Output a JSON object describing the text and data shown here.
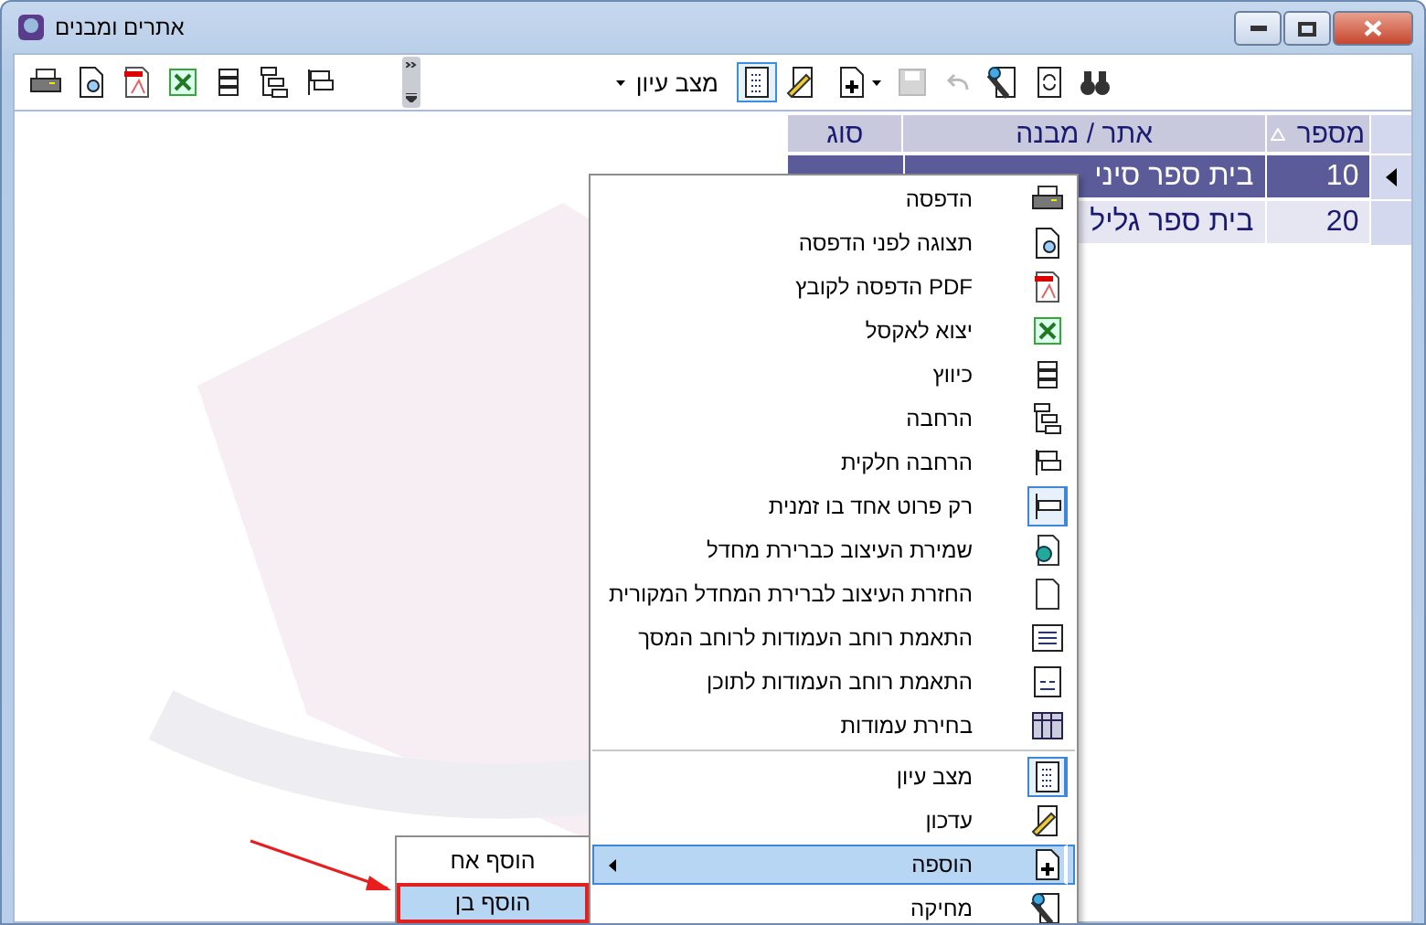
{
  "window": {
    "title": "אתרים ומבנים"
  },
  "toolbar": {
    "left_tools": [
      {
        "disabled": false
      },
      {
        "disabled": false
      },
      {
        "disabled": false
      },
      {
        "disabled": false
      },
      {
        "disabled": false
      },
      {
        "disabled": false
      },
      {
        "disabled": false
      }
    ],
    "view_mode": {
      "value": "מצב עיון"
    },
    "right_tools": [
      {
        "selected": true,
        "disabled": false,
        "dropdown": false
      },
      {
        "selected": false,
        "disabled": false,
        "dropdown": false
      },
      {
        "selected": false,
        "disabled": false,
        "dropdown": true
      },
      {
        "selected": false,
        "disabled": true,
        "dropdown": false
      },
      {
        "selected": false,
        "disabled": true,
        "dropdown": false
      },
      {
        "selected": false,
        "disabled": false,
        "dropdown": false
      },
      {
        "selected": false,
        "disabled": false,
        "dropdown": false
      },
      {
        "selected": false,
        "disabled": false,
        "dropdown": false
      }
    ]
  },
  "table": {
    "columns": [
      {
        "label": "מספר",
        "sorted": true
      },
      {
        "label": "אתר / מבנה",
        "sorted": false
      },
      {
        "label": "סוג",
        "sorted": false
      }
    ],
    "rows": [
      {
        "cells": [
          "10",
          "בית ספר סיני"
        ],
        "selected": true,
        "current": true
      },
      {
        "cells": [
          "20",
          "בית ספר גליל"
        ],
        "selected": false,
        "current": false
      }
    ]
  },
  "context_menu": {
    "items": [
      {
        "kind": "item",
        "label": "הדפסה",
        "checked": false,
        "highlighted": false,
        "submenu": false
      },
      {
        "kind": "item",
        "label": "תצוגה לפני הדפסה",
        "checked": false,
        "highlighted": false,
        "submenu": false
      },
      {
        "kind": "item",
        "label": "PDF הדפסה לקובץ",
        "checked": false,
        "highlighted": false,
        "submenu": false
      },
      {
        "kind": "item",
        "label": "יצוא לאקסל",
        "checked": false,
        "highlighted": false,
        "submenu": false
      },
      {
        "kind": "item",
        "label": "כיווץ",
        "checked": false,
        "highlighted": false,
        "submenu": false
      },
      {
        "kind": "item",
        "label": "הרחבה",
        "checked": false,
        "highlighted": false,
        "submenu": false
      },
      {
        "kind": "item",
        "label": "הרחבה חלקית",
        "checked": false,
        "highlighted": false,
        "submenu": false
      },
      {
        "kind": "item",
        "label": "רק פרוט אחד בו זמנית",
        "checked": true,
        "highlighted": false,
        "submenu": false
      },
      {
        "kind": "item",
        "label": "שמירת  העיצוב כברירת מחדל",
        "checked": false,
        "highlighted": false,
        "submenu": false
      },
      {
        "kind": "item",
        "label": "החזרת  העיצוב לברירת המחדל המקורית",
        "checked": false,
        "highlighted": false,
        "submenu": false
      },
      {
        "kind": "item",
        "label": "התאמת רוחב העמודות לרוחב המסך",
        "checked": false,
        "highlighted": false,
        "submenu": false
      },
      {
        "kind": "item",
        "label": "התאמת רוחב העמודות לתוכן",
        "checked": false,
        "highlighted": false,
        "submenu": false
      },
      {
        "kind": "item",
        "label": "בחירת עמודות",
        "checked": false,
        "highlighted": false,
        "submenu": false
      },
      {
        "kind": "separator"
      },
      {
        "kind": "item",
        "label": "מצב עיון",
        "checked": true,
        "highlighted": false,
        "submenu": false
      },
      {
        "kind": "item",
        "label": "עדכון",
        "checked": false,
        "highlighted": false,
        "submenu": false
      },
      {
        "kind": "item",
        "label": "הוספה",
        "checked": false,
        "highlighted": true,
        "submenu": true
      },
      {
        "kind": "item",
        "label": "מחיקה",
        "checked": false,
        "highlighted": false,
        "submenu": false
      }
    ]
  },
  "submenu": {
    "items": [
      {
        "label": "הוסף אח",
        "highlighted": false,
        "marked": false
      },
      {
        "label": "הוסף בן",
        "highlighted": true,
        "marked": true
      }
    ]
  }
}
